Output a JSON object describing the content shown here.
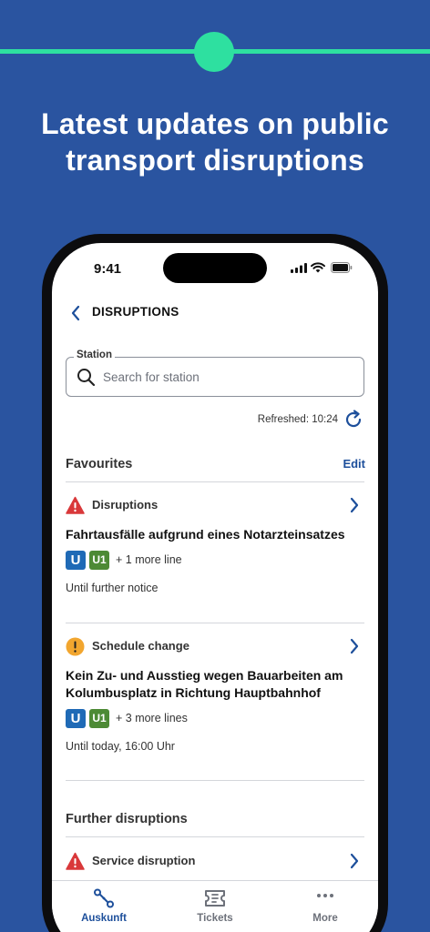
{
  "headline": {
    "line1": "Latest updates on public",
    "line2": "transport disruptions"
  },
  "status_bar": {
    "time": "9:41"
  },
  "nav": {
    "title": "DISRUPTIONS"
  },
  "search": {
    "legend": "Station",
    "placeholder": "Search for station"
  },
  "refreshed": "Refreshed: 10:24",
  "favourites": {
    "title": "Favourites",
    "edit_label": "Edit",
    "items": [
      {
        "type_label": "Disruptions",
        "type_icon": "warning-triangle-icon",
        "title": "Fahrtausfälle aufgrund eines Notarzteinsatzes",
        "badges": [
          "U",
          "U1"
        ],
        "more_lines": "+ 1 more line",
        "validity": "Until further notice"
      },
      {
        "type_label": "Schedule change",
        "type_icon": "exclamation-circle-icon",
        "title": "Kein Zu- und Ausstieg wegen Bauarbeiten am Kolumbusplatz in Richtung Hauptbahnhof",
        "badges": [
          "U",
          "U1"
        ],
        "more_lines": "+ 3 more lines",
        "validity": "Until today, 16:00 Uhr"
      }
    ]
  },
  "further": {
    "title": "Further disruptions",
    "items": [
      {
        "type_label": "Service disruption",
        "type_icon": "warning-triangle-icon"
      }
    ]
  },
  "tabs": [
    {
      "label": "Auskunft",
      "icon": "route-icon",
      "active": true
    },
    {
      "label": "Tickets",
      "icon": "ticket-icon",
      "active": false
    },
    {
      "label": "More",
      "icon": "more-dots-icon",
      "active": false
    }
  ],
  "colors": {
    "background": "#2a54a0",
    "accent_green": "#2ee0a0",
    "link_blue": "#1d4f9b",
    "alert_red": "#d9383a",
    "warning_orange": "#f2a62f",
    "u_bahn_blue": "#1f6ab6",
    "line_u1_green": "#4d8a35",
    "tab_inactive": "#6d717a"
  }
}
